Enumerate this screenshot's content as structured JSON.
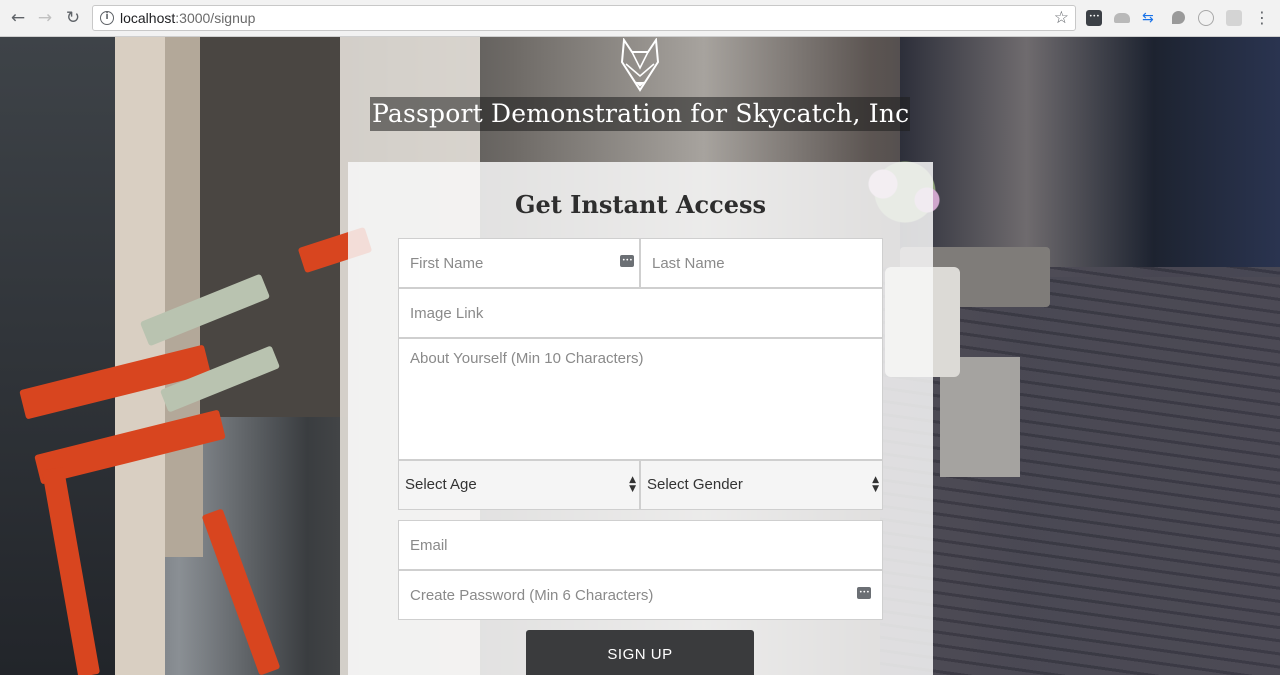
{
  "browser": {
    "url_host": "localhost",
    "url_rest": ":3000/signup",
    "back_icon": "arrow-left-icon",
    "forward_icon": "arrow-right-icon",
    "reload_icon": "reload-icon"
  },
  "header": {
    "title": "Passport Demonstration for Skycatch, Inc"
  },
  "form": {
    "heading": "Get Instant Access",
    "first_name_placeholder": "First Name",
    "last_name_placeholder": "Last Name",
    "image_link_placeholder": "Image Link",
    "about_placeholder": "About Yourself (Min 10 Characters)",
    "age_select": "Select Age",
    "gender_select": "Select Gender",
    "email_placeholder": "Email",
    "password_placeholder": "Create Password (Min 6 Characters)",
    "submit_label": "SIGN UP"
  },
  "colors": {
    "button_bg": "#3a3b3d",
    "card_bg": "#f7f7f7"
  }
}
